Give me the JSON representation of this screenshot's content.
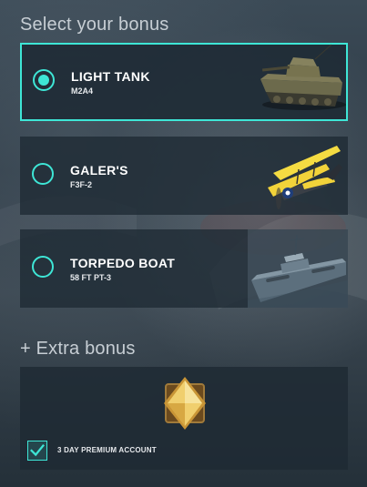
{
  "sections": {
    "select_title": "Select your bonus",
    "extra_title": "+ Extra bonus"
  },
  "options": [
    {
      "name": "LIGHT TANK",
      "sub": "M2A4",
      "selected": true,
      "icon": "light-tank-icon"
    },
    {
      "name": "GALER'S",
      "sub": "F3F-2",
      "selected": false,
      "icon": "biplane-icon"
    },
    {
      "name": "TORPEDO BOAT",
      "sub": "58 FT PT-3",
      "selected": false,
      "icon": "torpedo-boat-icon"
    }
  ],
  "extra": {
    "badge_icon": "premium-diamond-icon",
    "checkbox_checked": true,
    "checkbox_label": "3 DAY PREMIUM ACCOUNT"
  },
  "colors": {
    "accent": "#3ee6d6",
    "panel": "#202c36",
    "badge_gold": "#e9b64a"
  }
}
